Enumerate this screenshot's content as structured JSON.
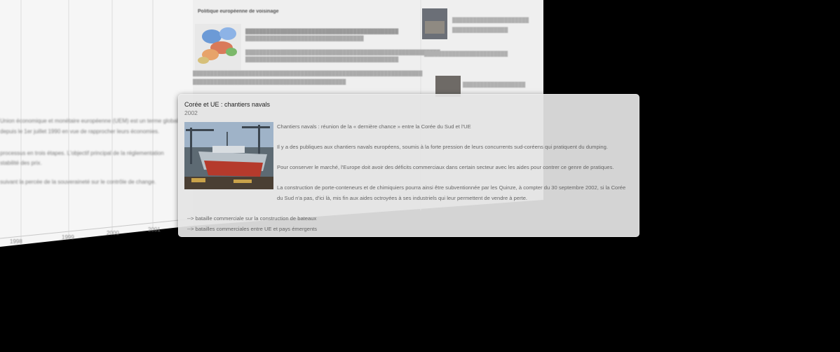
{
  "background": {
    "section_heading": "Politique européenne de voisinage",
    "year_ticks": [
      "1998",
      "1999",
      "2000",
      "2001"
    ],
    "left_lines": [
      "Union économique et monétaire européenne (UEM) est un terme global",
      "depuis le 1er juillet 1990 en vue de rapprocher leurs économies.",
      "processus en trois étapes. L'objectif principal de la réglementation",
      "stabilité des prix.",
      "suivant la percée de la souveraineté sur le contrôle de change."
    ]
  },
  "card": {
    "title": "Corée et UE : chantiers navals",
    "year": "2002",
    "photo_caption": "shipyard-photo",
    "paragraphs": [
      "Chantiers navals : réunion de la « dernière chance » entre la Corée du Sud et l'UE",
      "Il y a des publiques aux chantiers navals européens, soumis à la forte pression de leurs concurrents sud-coréens qui pratiquent du dumping.",
      "Pour conserver le marché, l'Europe doit avoir des déficits commerciaux dans certain secteur avec les aides pour contrer ce genre de pratiques.",
      "La construction de porte-conteneurs et de chimiquiers pourra ainsi être subventionnée par les Quinze, à compter du 30 septembre 2002, si la Corée du Sud n'a pas, d'ici là, mis fin aux aides octroyées à ses industriels qui leur permettent de vendre à perte."
    ],
    "related": [
      "--> bataille commerciale sur la construction de bateaux",
      "--> batailles commerciales entre UE et pays émergents"
    ]
  },
  "colors": {
    "background": "#000000",
    "card": "#e4e4e4",
    "wall": "#f4f4f4"
  }
}
